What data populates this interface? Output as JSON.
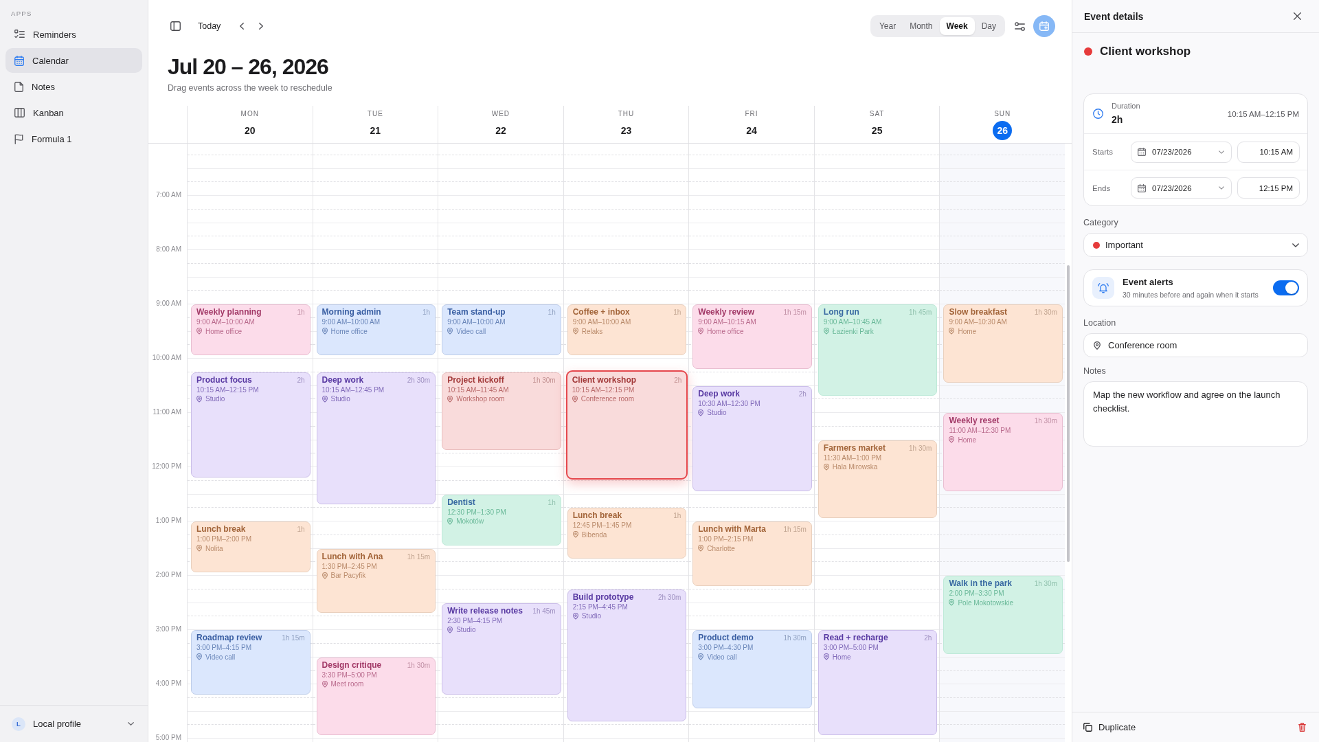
{
  "sidebar": {
    "section_label": "APPS",
    "items": [
      {
        "label": "Reminders",
        "selected": false
      },
      {
        "label": "Calendar",
        "selected": true
      },
      {
        "label": "Notes",
        "selected": false
      },
      {
        "label": "Kanban",
        "selected": false
      },
      {
        "label": "Formula 1",
        "selected": false
      }
    ],
    "profile": {
      "initial": "L",
      "name": "Local profile"
    }
  },
  "toolbar": {
    "today": "Today",
    "views": [
      {
        "label": "Year",
        "selected": false
      },
      {
        "label": "Month",
        "selected": false
      },
      {
        "label": "Week",
        "selected": true
      },
      {
        "label": "Day",
        "selected": false
      }
    ]
  },
  "header": {
    "title": "Jul 20 – 26, 2026",
    "subtitle": "Drag events across the week to reschedule"
  },
  "calendar": {
    "days": [
      {
        "name": "MON",
        "date": "20",
        "today": false,
        "events": [
          {
            "title": "Weekly planning",
            "duration": "1h",
            "time": "9:00 AM–10:00 AM",
            "location": "Home office",
            "color": "#fcdcea",
            "selected": false
          },
          {
            "title": "Product focus",
            "duration": "2h",
            "time": "10:15 AM–12:15 PM",
            "location": "Studio",
            "color": "#e8e0fb",
            "selected": false
          },
          {
            "title": "Lunch break",
            "duration": "1h",
            "time": "1:00 PM–2:00 PM",
            "location": "Nolita",
            "color": "#fde4d3",
            "selected": false
          },
          {
            "title": "Roadmap review",
            "duration": "1h 15m",
            "time": "3:00 PM–4:15 PM",
            "location": "Video call",
            "color": "#dbe7fd",
            "selected": false
          }
        ]
      },
      {
        "name": "TUE",
        "date": "21",
        "today": false,
        "events": [
          {
            "title": "Morning admin",
            "duration": "1h",
            "time": "9:00 AM–10:00 AM",
            "location": "Home office",
            "color": "#dbe7fd",
            "selected": false
          },
          {
            "title": "Deep work",
            "duration": "2h 30m",
            "time": "10:15 AM–12:45 PM",
            "location": "Studio",
            "color": "#e8e0fb",
            "selected": false
          },
          {
            "title": "Lunch with Ana",
            "duration": "1h 15m",
            "time": "1:30 PM–2:45 PM",
            "location": "Bar Pacyfik",
            "color": "#fde4d3",
            "selected": false
          },
          {
            "title": "Design critique",
            "duration": "1h 30m",
            "time": "3:30 PM–5:00 PM",
            "location": "Meet room",
            "color": "#fcdcea",
            "selected": false
          }
        ]
      },
      {
        "name": "WED",
        "date": "22",
        "today": false,
        "events": [
          {
            "title": "Team stand-up",
            "duration": "1h",
            "time": "9:00 AM–10:00 AM",
            "location": "Video call",
            "color": "#dbe7fd",
            "selected": false
          },
          {
            "title": "Project kickoff",
            "duration": "1h 30m",
            "time": "10:15 AM–11:45 AM",
            "location": "Workshop room",
            "color": "#f9dbdb",
            "selected": false
          },
          {
            "title": "Dentist",
            "duration": "1h",
            "time": "12:30 PM–1:30 PM",
            "location": "Mokotów",
            "color": "#d2f2e5",
            "selected": false
          },
          {
            "title": "Write release notes",
            "duration": "1h 45m",
            "time": "2:30 PM–4:15 PM",
            "location": "Studio",
            "color": "#e8e0fb",
            "selected": false
          }
        ]
      },
      {
        "name": "THU",
        "date": "23",
        "today": false,
        "events": [
          {
            "title": "Coffee + inbox",
            "duration": "1h",
            "time": "9:00 AM–10:00 AM",
            "location": "Relaks",
            "color": "#fde4d3",
            "selected": false
          },
          {
            "title": "Client workshop",
            "duration": "2h",
            "time": "10:15 AM–12:15 PM",
            "location": "Conference room",
            "color": "#f9dbdb",
            "selected": true
          },
          {
            "title": "Lunch break",
            "duration": "1h",
            "time": "12:45 PM–1:45 PM",
            "location": "Bibenda",
            "color": "#fde4d3",
            "selected": false
          },
          {
            "title": "Build prototype",
            "duration": "2h 30m",
            "time": "2:15 PM–4:45 PM",
            "location": "Studio",
            "color": "#e8e0fb",
            "selected": false
          }
        ]
      },
      {
        "name": "FRI",
        "date": "24",
        "today": false,
        "events": [
          {
            "title": "Weekly review",
            "duration": "1h 15m",
            "time": "9:00 AM–10:15 AM",
            "location": "Home office",
            "color": "#fcdcea",
            "selected": false
          },
          {
            "title": "Deep work",
            "duration": "2h",
            "time": "10:30 AM–12:30 PM",
            "location": "Studio",
            "color": "#e8e0fb",
            "selected": false
          },
          {
            "title": "Lunch with Marta",
            "duration": "1h 15m",
            "time": "1:00 PM–2:15 PM",
            "location": "Charlotte",
            "color": "#fde4d3",
            "selected": false
          },
          {
            "title": "Product demo",
            "duration": "1h 30m",
            "time": "3:00 PM–4:30 PM",
            "location": "Video call",
            "color": "#dbe7fd",
            "selected": false
          }
        ]
      },
      {
        "name": "SAT",
        "date": "25",
        "today": false,
        "events": [
          {
            "title": "Long run",
            "duration": "1h 45m",
            "time": "9:00 AM–10:45 AM",
            "location": "Łazienki Park",
            "color": "#d2f2e5",
            "selected": false
          },
          {
            "title": "Farmers market",
            "duration": "1h 30m",
            "time": "11:30 AM–1:00 PM",
            "location": "Hala Mirowska",
            "color": "#fde4d3",
            "selected": false
          },
          {
            "title": "Read + recharge",
            "duration": "2h",
            "time": "3:00 PM–5:00 PM",
            "location": "Home",
            "color": "#e8e0fb",
            "selected": false
          }
        ]
      },
      {
        "name": "SUN",
        "date": "26",
        "today": true,
        "events": [
          {
            "title": "Slow breakfast",
            "duration": "1h 30m",
            "time": "9:00 AM–10:30 AM",
            "location": "Home",
            "color": "#fde4d3",
            "selected": false
          },
          {
            "title": "Weekly reset",
            "duration": "1h 30m",
            "time": "11:00 AM–12:30 PM",
            "location": "Home",
            "color": "#fcdcea",
            "selected": false
          },
          {
            "title": "Walk in the park",
            "duration": "1h 30m",
            "time": "2:00 PM–3:30 PM",
            "location": "Pole Mokotowskie",
            "color": "#d2f2e5",
            "selected": false
          }
        ]
      }
    ],
    "hours": [
      "7:00 AM",
      "8:00 AM",
      "9:00 AM",
      "10:00 AM",
      "11:00 AM",
      "12:00 PM",
      "1:00 PM",
      "2:00 PM",
      "3:00 PM",
      "4:00 PM",
      "5:00 PM"
    ]
  },
  "details": {
    "title": "Event details",
    "event": {
      "title": "Client workshop",
      "color": "#e63b3b"
    },
    "duration": {
      "label": "Duration",
      "value": "2h",
      "range": "10:15 AM–12:15 PM"
    },
    "starts": {
      "label": "Starts",
      "date": "07/23/2026",
      "time": "10:15 AM"
    },
    "ends": {
      "label": "Ends",
      "date": "07/23/2026",
      "time": "12:15 PM"
    },
    "category": {
      "label": "Category",
      "value": "Important",
      "color": "#e63b3b"
    },
    "alerts": {
      "title": "Event alerts",
      "subtitle": "30 minutes before and again when it starts",
      "on": true
    },
    "location": {
      "label": "Location",
      "value": "Conference room"
    },
    "notes": {
      "label": "Notes",
      "value": "Map the new workflow and agree on the launch checklist."
    },
    "actions": {
      "duplicate": "Duplicate"
    }
  }
}
